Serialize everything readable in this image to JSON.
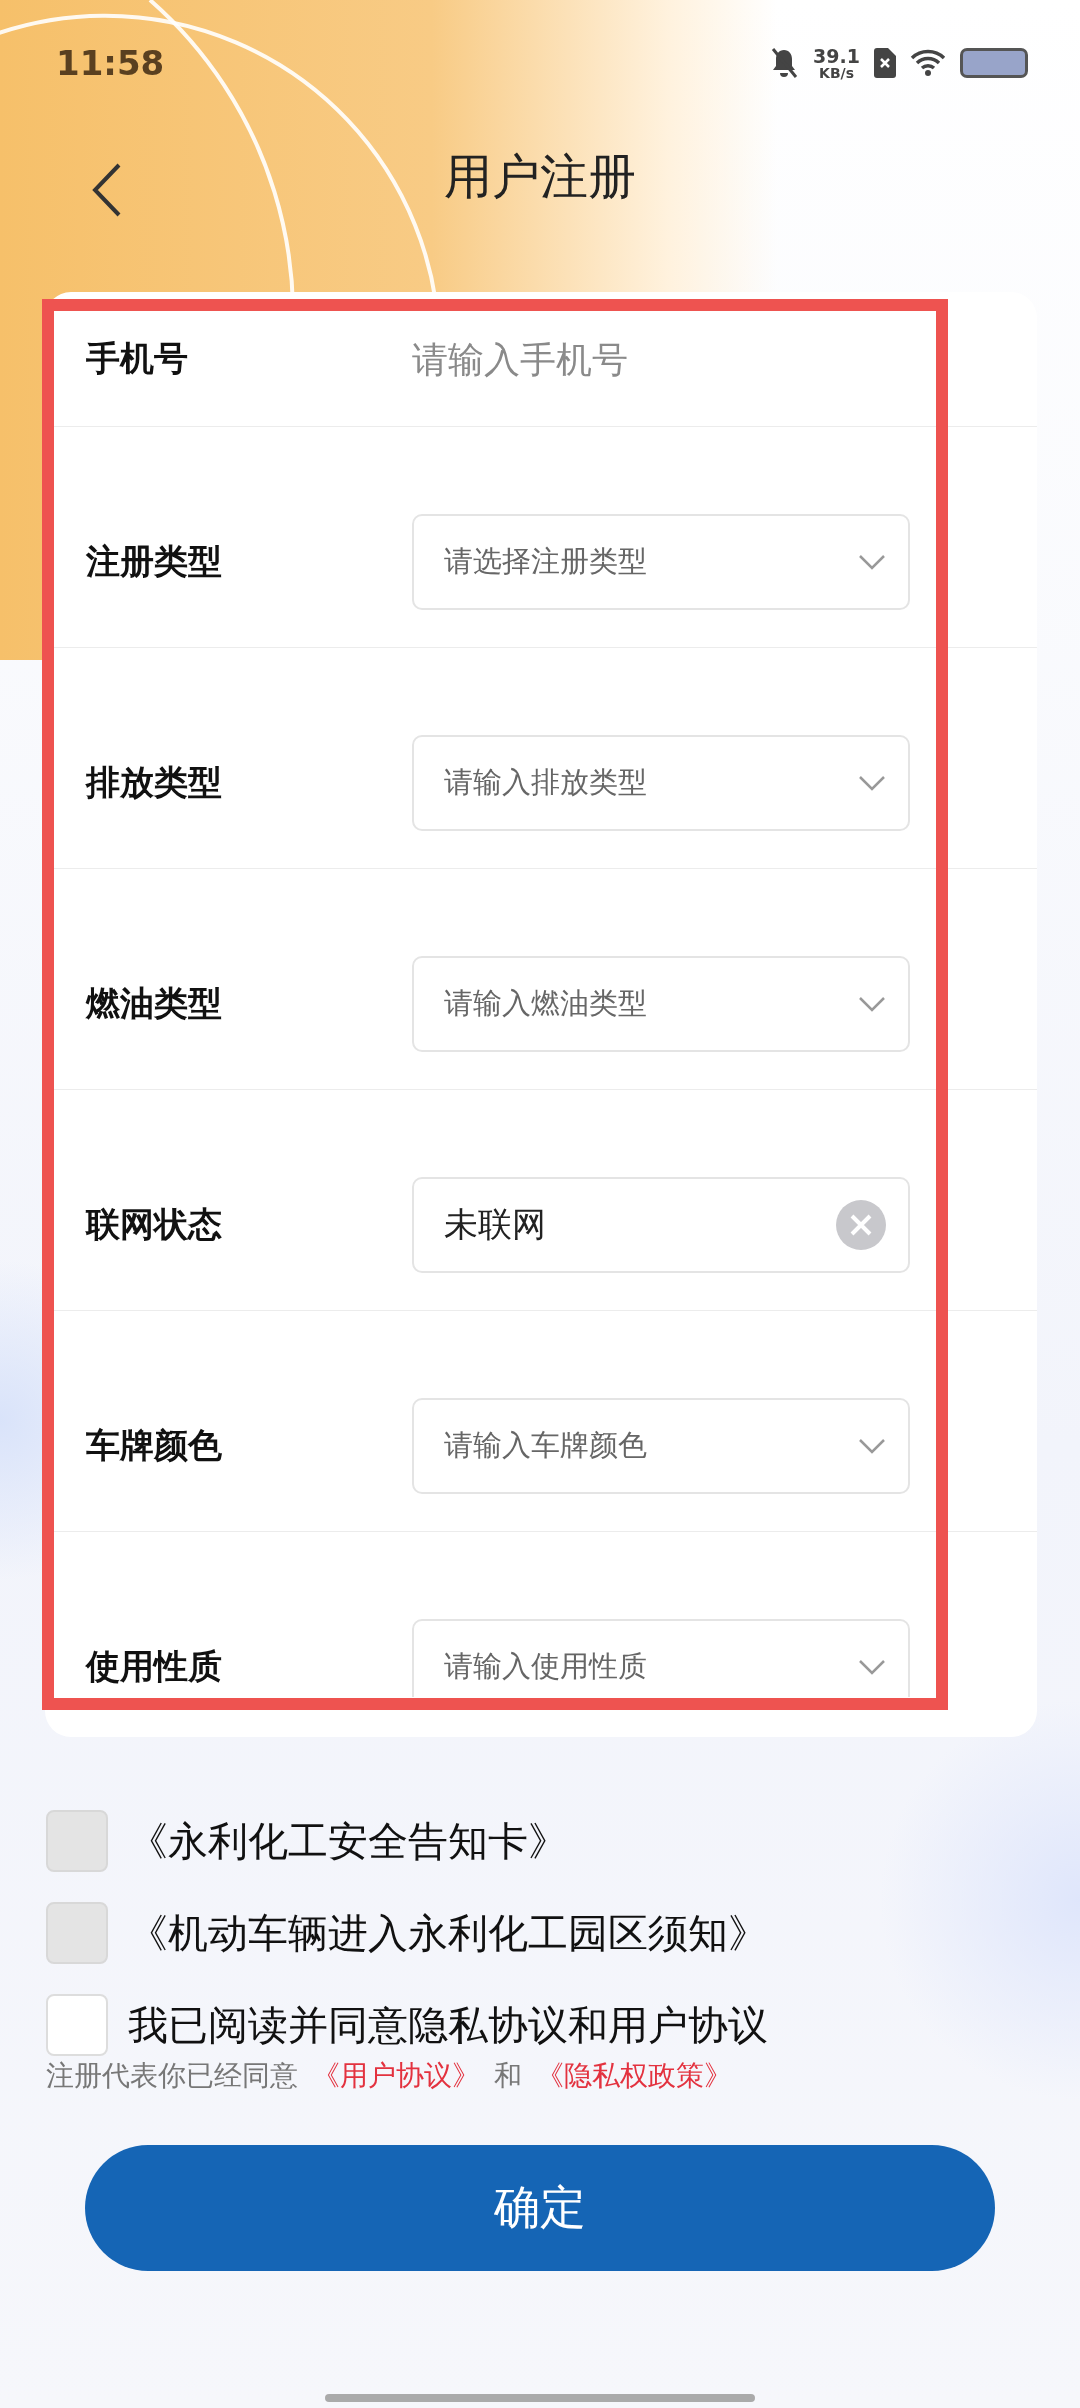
{
  "status_bar": {
    "time": "11:58",
    "net_speed": "39.1",
    "net_unit": "KB/s"
  },
  "header": {
    "title": "用户注册"
  },
  "form": {
    "fields": [
      {
        "kind": "text",
        "label": "手机号",
        "placeholder": "请输入手机号"
      },
      {
        "kind": "select",
        "label": "注册类型",
        "placeholder": "请选择注册类型"
      },
      {
        "kind": "select",
        "label": "排放类型",
        "placeholder": "请输入排放类型"
      },
      {
        "kind": "select",
        "label": "燃油类型",
        "placeholder": "请输入燃油类型"
      },
      {
        "kind": "clearable",
        "label": "联网状态",
        "value": "未联网"
      },
      {
        "kind": "select",
        "label": "车牌颜色",
        "placeholder": "请输入车牌颜色"
      },
      {
        "kind": "select",
        "label": "使用性质",
        "placeholder": "请输入使用性质"
      }
    ]
  },
  "agreements": [
    {
      "label": "《永利化工安全告知卡》",
      "checked": false,
      "disabled": true
    },
    {
      "label": "《机动车辆进入永利化工园区须知》",
      "checked": false,
      "disabled": true
    },
    {
      "label": "我已阅读并同意隐私协议和用户协议",
      "checked": false,
      "disabled": false
    }
  ],
  "notice": {
    "text": "注册代表你已经同意",
    "link_1": "《用户协议》",
    "joiner": "和",
    "link_2": "《隐私权政策》"
  },
  "submit_button": "确定"
}
